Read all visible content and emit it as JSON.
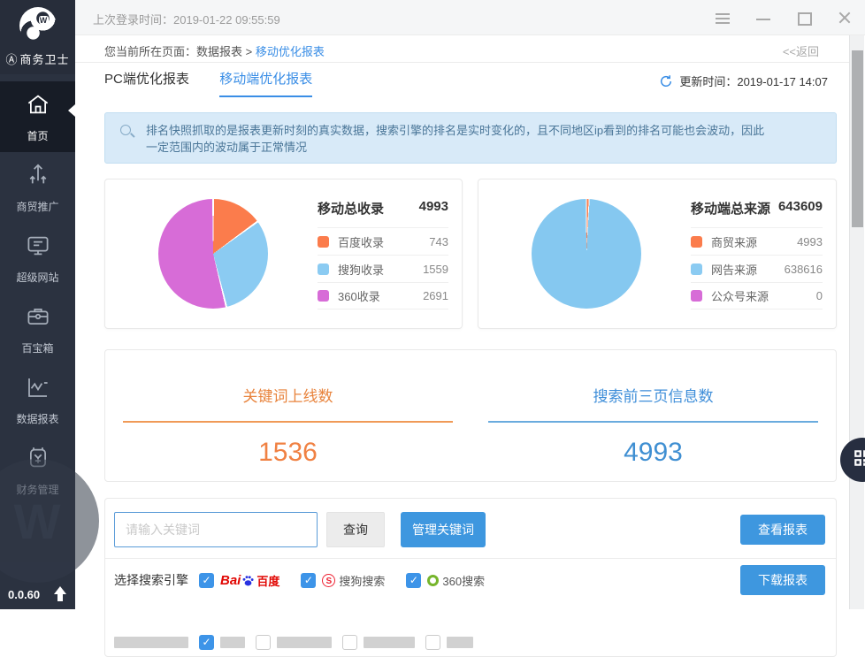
{
  "titlebar": {
    "last_login": "上次登录时间：2019-01-22 09:55:59"
  },
  "sidebar": {
    "brand_badge": "Ⓐ",
    "brand": "商务卫士",
    "version": "0.0.60",
    "items": [
      {
        "label": "首页",
        "active": true
      },
      {
        "label": "商贸推广",
        "active": false
      },
      {
        "label": "超级网站",
        "active": false
      },
      {
        "label": "百宝箱",
        "active": false
      },
      {
        "label": "数据报表",
        "active": false
      },
      {
        "label": "财务管理",
        "active": false
      }
    ]
  },
  "breadcrumb": {
    "prefix": "您当前所在页面：数据报表 >",
    "current": "移动优化报表",
    "back": "<<返回"
  },
  "tabs": {
    "pc": "PC端优化报表",
    "mobile": "移动端优化报表"
  },
  "update_time": "更新时间：2019-01-17 14:07",
  "notice": "排名快照抓取的是报表更新时刻的真实数据，搜索引擎的排名是实时变化的，且不同地区ip看到的排名可能也会波动，因此一定范围内的波动属于正常情况",
  "chart_data": [
    {
      "type": "pie",
      "title": "移动总收录",
      "total": 4993,
      "labels": [
        "百度收录",
        "搜狗收录",
        "360收录"
      ],
      "values": [
        743,
        1559,
        2691
      ],
      "colors": [
        "#fb7c4c",
        "#8bcbf2",
        "#d76cd7"
      ],
      "legend_position": "right"
    },
    {
      "type": "pie",
      "title": "移动端总来源",
      "total": 643609,
      "labels": [
        "商贸来源",
        "网告来源",
        "公众号来源"
      ],
      "values": [
        4993,
        638616,
        0
      ],
      "colors": [
        "#fb7c4c",
        "#8bcbf2",
        "#d76cd7"
      ],
      "legend_position": "right"
    }
  ],
  "card1": {
    "title": "移动总收录",
    "total": "4993",
    "legend": [
      {
        "label": "百度收录",
        "value": "743"
      },
      {
        "label": "搜狗收录",
        "value": "1559"
      },
      {
        "label": "360收录",
        "value": "2691"
      }
    ]
  },
  "card2": {
    "title": "移动端总来源",
    "total": "643609",
    "legend": [
      {
        "label": "商贸来源",
        "value": "4993"
      },
      {
        "label": "网告来源",
        "value": "638616"
      },
      {
        "label": "公众号来源",
        "value": "0"
      }
    ]
  },
  "stats": {
    "left_title": "关键词上线数",
    "left_value": "1536",
    "right_title": "搜索前三页信息数",
    "right_value": "4993"
  },
  "toolbar": {
    "placeholder": "请输入关键词",
    "query": "查询",
    "manage": "管理关键词",
    "view_report": "查看报表",
    "download_report": "下载报表"
  },
  "engines": {
    "label": "选择搜索引擎",
    "baidu_bai": "Bai",
    "baidu_cn": "百度",
    "sogou_s": "S",
    "sogou": "搜狗搜索",
    "so360": "360搜索"
  },
  "colors": {
    "accent_blue": "#3a8ee6",
    "button_blue": "#3e97df",
    "checkbox_blue": "#3d94e8",
    "stat_orange": "#f08143",
    "stat_blue": "#3f8fd2",
    "pie_orange": "#fb7c4c",
    "pie_blue": "#8bcbf2",
    "pie_magenta": "#d76cd7",
    "sidebar_bg": "#2b3240",
    "notice_bg": "#d8eaf8"
  }
}
